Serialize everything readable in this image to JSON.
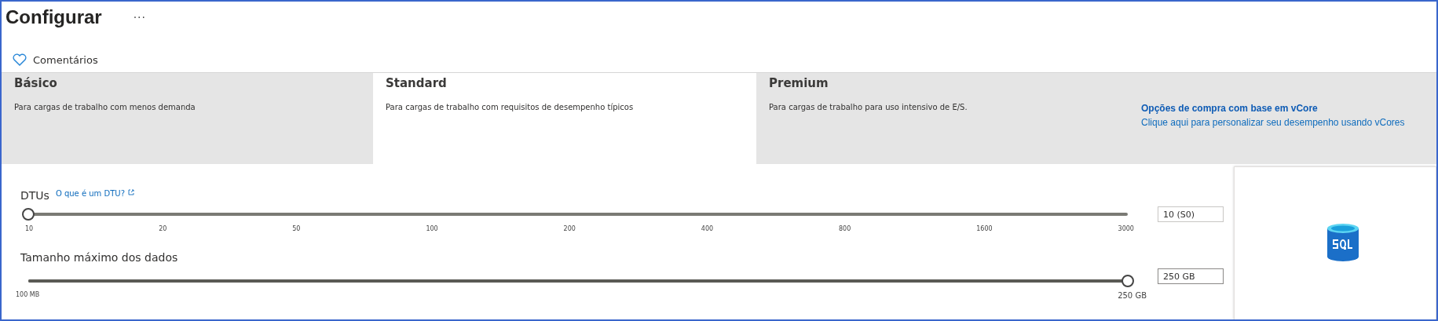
{
  "header": {
    "title": "Configurar",
    "more": "···",
    "feedback": "Comentários"
  },
  "tabs": [
    {
      "label": "Básico",
      "description": "Para cargas de trabalho com menos demanda",
      "selected": false
    },
    {
      "label": "Standard",
      "description": "Para cargas de trabalho com requisitos de desempenho típicos",
      "selected": true
    },
    {
      "label": "Premium",
      "description": "Para cargas de trabalho para uso intensivo de E/S.",
      "selected": false
    }
  ],
  "vcore": {
    "title": "Opções de compra com base em vCore",
    "link": "Clique aqui para personalizar seu desempenho usando vCores"
  },
  "sliders": [
    {
      "kind": "ticks",
      "label": "DTUs",
      "help_link": "O que é um DTU?",
      "level": 0,
      "ticks": [
        "10",
        "20",
        "50",
        "100",
        "200",
        "400",
        "800",
        "1600",
        "3000"
      ],
      "value": "10 (S0)"
    },
    {
      "kind": "range",
      "label": "Tamanho máximo dos dados",
      "level": 1,
      "min_label": "100 MB",
      "max_label": "250 GB",
      "value": "250 GB"
    }
  ]
}
